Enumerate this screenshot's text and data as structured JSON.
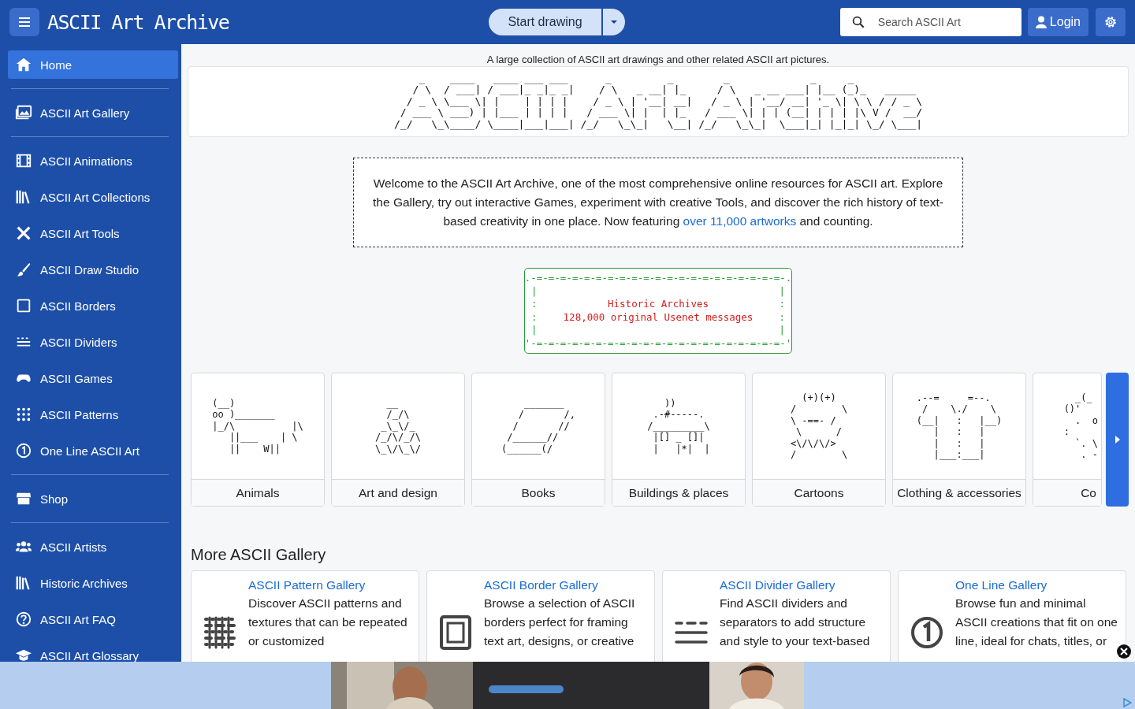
{
  "header": {
    "logo": "ASCII Art Archive",
    "start_button": "Start drawing",
    "search": {
      "placeholder": "Search ASCII Art"
    },
    "login": "Login"
  },
  "sidebar": {
    "groups": [
      {
        "items": [
          {
            "label": "Home",
            "selected": true
          }
        ]
      },
      {
        "items": [
          {
            "label": "ASCII Art Gallery",
            "selected": false
          }
        ]
      },
      {
        "items": [
          {
            "label": "ASCII Animations",
            "selected": false
          },
          {
            "label": "ASCII Art Collections",
            "selected": false
          },
          {
            "label": "ASCII Art Tools",
            "selected": false
          },
          {
            "label": "ASCII Draw Studio",
            "selected": false
          },
          {
            "label": "ASCII Borders",
            "selected": false
          },
          {
            "label": "ASCII Dividers",
            "selected": false
          },
          {
            "label": "ASCII Games",
            "selected": false
          },
          {
            "label": "ASCII Patterns",
            "selected": false
          },
          {
            "label": "One Line ASCII Art",
            "selected": false
          }
        ]
      },
      {
        "items": [
          {
            "label": "Shop",
            "selected": false
          }
        ]
      },
      {
        "items": [
          {
            "label": "ASCII Artists",
            "selected": false
          },
          {
            "label": "Historic Archives",
            "selected": false
          },
          {
            "label": "ASCII Art FAQ",
            "selected": false
          },
          {
            "label": "ASCII Art Glossary",
            "selected": false
          }
        ]
      }
    ]
  },
  "tagline": "A large collection of ASCII art drawings and other related ASCII art pictures.",
  "title_art": [
    "    _    ____   ____ ___ ___      _         _        _             _     _           ",
    "   / \\  / ___| / ___|_ _|_ _|    / \\   _ __| |_     / \\   _ __ ___| |__ (_)_   _____ ",
    "  / _ \\ \\___ \\| |    | | | |    / _ \\ | '__| __|   / _ \\ | '__/ __| '_ \\| \\ \\ / / _ \\",
    " / ___ \\ ___) | |___ | | | |   / ___ \\| |  | |_   / ___ \\| | | (__| | | | |\\ V /  __/",
    "/_/   \\_\\____/ \\____|___|___| /_/   \\_\\_|   \\__| /_/   \\_\\_|  \\___|_| |_|_| \\_/ \\___|"
  ],
  "welcome": {
    "before": "Welcome to the ASCII Art Archive, one of the most comprehensive online resources for ASCII art. Explore the Gallery, try out interactive Games, experiment with creative Tools, and discover the rich history of text-based creativity in one place. Now featuring ",
    "link": "over 11,000 artworks",
    "after": " and counting."
  },
  "usenet": {
    "top": ".-=-=-=-=-=-=-=-=-=-=-=-=-=-=-=-=-=-=-=-=-=-.",
    "bottom": "'-=-=-=-=-=-=-=-=-=-=-=-=-=-=-=-=-=-=-=-=-=-'",
    "rows": [
      {
        "left": "|",
        "text": "",
        "right": "|"
      },
      {
        "left": ":",
        "text": "Historic Archives",
        "right": ":"
      },
      {
        "left": ":",
        "text": "128,000 original Usenet messages",
        "right": ":"
      },
      {
        "left": "|",
        "text": "",
        "right": "|"
      }
    ]
  },
  "categories": [
    {
      "label": "Animals",
      "clipped": false,
      "art": [
        "(__)",
        "oo )_______",
        "|_/\\          |\\",
        "   ||___    | \\",
        "   ||    W||"
      ]
    },
    {
      "label": "Art and design",
      "clipped": false,
      "art": [
        "  __",
        "  /_/\\",
        " _\\_\\/_",
        "/_/\\/_/\\",
        "\\_\\/\\_\\/"
      ]
    },
    {
      "label": "Books",
      "clipped": false,
      "art": [
        "    _______",
        "   /       /,",
        "  /       //",
        " /______//",
        "(______(/"
      ]
    },
    {
      "label": "Buildings & places",
      "clipped": false,
      "art": [
        "   ))",
        " .-#-----.",
        "/_________\\",
        " |[] _ []|",
        " |   |*|  |"
      ]
    },
    {
      "label": "Cartoons",
      "clipped": false,
      "art": [
        "  (+)(+)",
        "/        \\",
        "\\ -==- /",
        " \\      /",
        "<\\/\\/\\/>",
        "/        \\"
      ]
    },
    {
      "label": "Clothing & accessories",
      "clipped": false,
      "art": [
        ".--=     =--.",
        " /    \\./    \\",
        "(__|   :   |__)",
        "   |   :   |",
        "   |   :   |",
        "   |___:___|"
      ]
    },
    {
      "label": "Co",
      "clipped": true,
      "art": [
        "  _(_",
        "()'",
        "  .  o",
        ":",
        "  `. \\",
        "   . -"
      ]
    }
  ],
  "more": {
    "heading": "More ASCII Gallery",
    "cards": [
      {
        "title": "ASCII Pattern Gallery",
        "description": "Discover ASCII patterns and textures that can be repeated or customized"
      },
      {
        "title": "ASCII Border Gallery",
        "description": "Browse a selection of ASCII borders perfect for framing text art, designs, or creative"
      },
      {
        "title": "ASCII Divider Gallery",
        "description": "Find ASCII dividers and separators to add structure and style to your text-based"
      },
      {
        "title": "One Line Gallery",
        "description": "Browse fun and minimal ASCII creations that fit on one line, ideal for chats, titles, or"
      }
    ]
  }
}
